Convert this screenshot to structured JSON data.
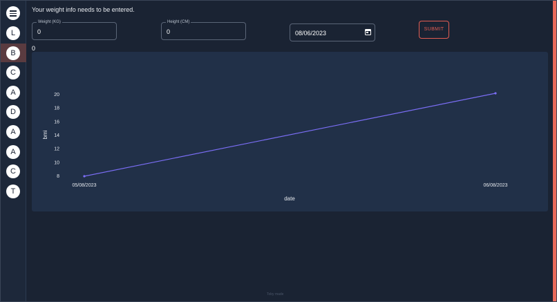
{
  "notice": "Your weight info needs to be entered.",
  "sidebar": {
    "menu_icon": "hamburger-menu-icon",
    "items": [
      {
        "label": "L"
      },
      {
        "label": "B",
        "active": true
      },
      {
        "label": "C"
      },
      {
        "label": "A"
      },
      {
        "label": "D"
      },
      {
        "label": "A"
      },
      {
        "label": "A"
      },
      {
        "label": "C"
      },
      {
        "label": "T"
      }
    ]
  },
  "form": {
    "weight": {
      "label": "Weight (KG)",
      "value": "0"
    },
    "height": {
      "label": "Height (CM)",
      "value": "0"
    },
    "date": {
      "value": "08/06/2023",
      "icon": "calendar-icon"
    },
    "submit_label": "SUBMIT"
  },
  "bmi_value": "0",
  "chart_data": {
    "type": "line",
    "x": [
      "05/08/2023",
      "06/08/2023"
    ],
    "series": [
      {
        "values": [
          8,
          20.2
        ]
      }
    ],
    "xlabel": "date",
    "ylabel": "bmi",
    "yticks": [
      8,
      10,
      12,
      14,
      16,
      18,
      20
    ],
    "ylim": [
      8,
      20.2
    ],
    "grid": false,
    "color": "#7b6ef6"
  },
  "footer": "Toby made",
  "colors": {
    "background": "#1a2333",
    "card": "#213048",
    "accent": "#e86a5b",
    "line": "#7b6ef6"
  }
}
